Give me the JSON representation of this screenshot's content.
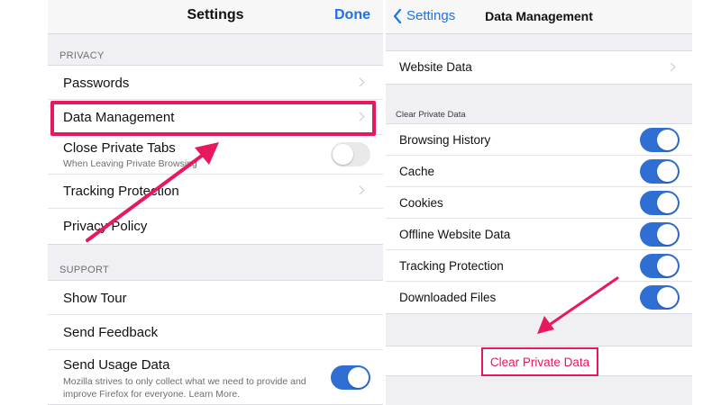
{
  "left_screen": {
    "title": "Settings",
    "done_label": "Done",
    "privacy_header": "PRIVACY",
    "privacy_items": {
      "passwords": "Passwords",
      "data_management": "Data Management",
      "close_private_tabs": "Close Private Tabs",
      "close_private_tabs_sub": "When Leaving Private Browsing",
      "tracking_protection": "Tracking Protection",
      "privacy_policy": "Privacy Policy"
    },
    "close_private_tabs_enabled": false,
    "support_header": "SUPPORT",
    "support_items": {
      "show_tour": "Show Tour",
      "send_feedback": "Send Feedback",
      "send_usage_data": "Send Usage Data",
      "send_usage_data_sub": "Mozilla strives to only collect what we need to provide and improve Firefox for everyone. Learn More."
    },
    "send_usage_data_enabled": true
  },
  "right_screen": {
    "back_label": "Settings",
    "title": "Data Management",
    "website_data": "Website Data",
    "clear_header": "Clear Private Data",
    "toggles": [
      {
        "label": "Browsing History",
        "on": true
      },
      {
        "label": "Cache",
        "on": true
      },
      {
        "label": "Cookies",
        "on": true
      },
      {
        "label": "Offline Website Data",
        "on": true
      },
      {
        "label": "Tracking Protection",
        "on": true
      },
      {
        "label": "Downloaded Files",
        "on": true
      }
    ],
    "clear_button": "Clear Private Data"
  },
  "colors": {
    "accent_blue": "#1a73e8",
    "toggle_on": "#2f6fd3",
    "annotation_pink": "#e8185f",
    "background_gray": "#efeff4"
  },
  "icons": [
    "chevron-left-icon",
    "chevron-right-icon",
    "toggle-switch",
    "annotation-arrow"
  ]
}
